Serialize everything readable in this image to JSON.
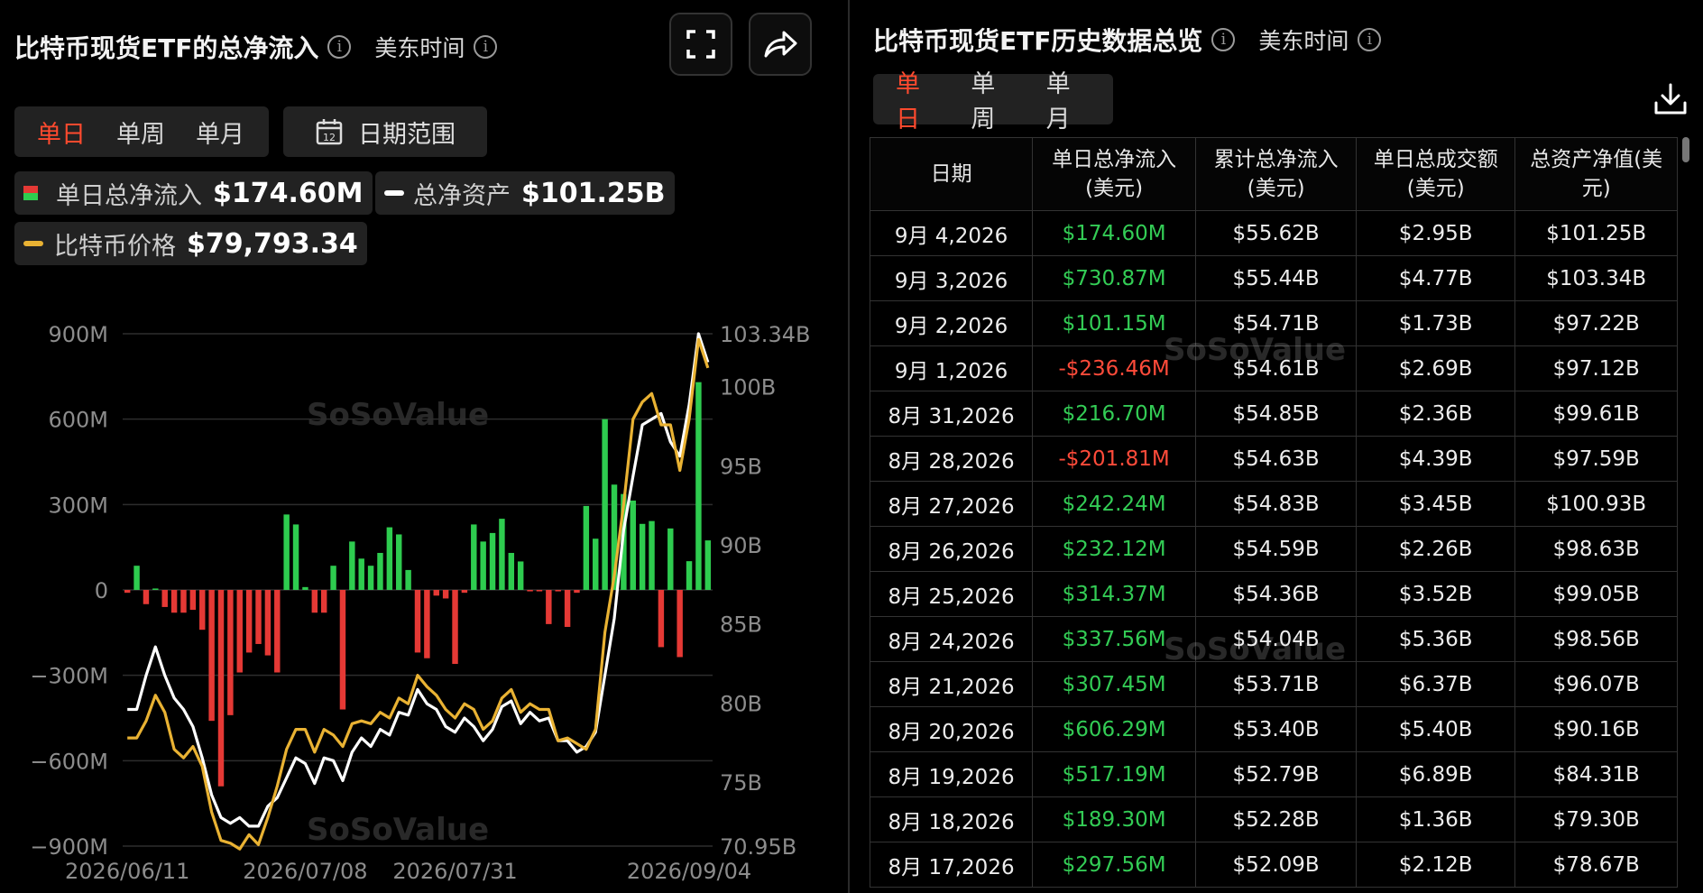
{
  "left": {
    "title": "比特币现货ETF的总净流入",
    "tz": "美东时间",
    "tabs": [
      "单日",
      "单周",
      "单月"
    ],
    "active_tab": 0,
    "date_range": "日期范围",
    "legend": [
      {
        "label": "单日总净流入",
        "value": "$174.60M"
      },
      {
        "label": "总净资产",
        "value": "$101.25B"
      },
      {
        "label": "比特币价格",
        "value": "$79,793.34"
      }
    ]
  },
  "right": {
    "title": "比特币现货ETF历史数据总览",
    "tz": "美东时间",
    "tabs": [
      "单日",
      "单周",
      "单月"
    ],
    "active_tab": 0,
    "columns": [
      [
        "日期",
        ""
      ],
      [
        "单日总净流入",
        "(美元)"
      ],
      [
        "累计总净流入",
        "(美元)"
      ],
      [
        "单日总成交额",
        "(美元)"
      ],
      [
        "总资产净值(美",
        "元)"
      ]
    ],
    "rows": [
      [
        "9月 4,2026",
        "$174.60M",
        "$55.62B",
        "$2.95B",
        "$101.25B"
      ],
      [
        "9月 3,2026",
        "$730.87M",
        "$55.44B",
        "$4.77B",
        "$103.34B"
      ],
      [
        "9月 2,2026",
        "$101.15M",
        "$54.71B",
        "$1.73B",
        "$97.22B"
      ],
      [
        "9月 1,2026",
        "-$236.46M",
        "$54.61B",
        "$2.69B",
        "$97.12B"
      ],
      [
        "8月 31,2026",
        "$216.70M",
        "$54.85B",
        "$2.36B",
        "$99.61B"
      ],
      [
        "8月 28,2026",
        "-$201.81M",
        "$54.63B",
        "$4.39B",
        "$97.59B"
      ],
      [
        "8月 27,2026",
        "$242.24M",
        "$54.83B",
        "$3.45B",
        "$100.93B"
      ],
      [
        "8月 26,2026",
        "$232.12M",
        "$54.59B",
        "$2.26B",
        "$98.63B"
      ],
      [
        "8月 25,2026",
        "$314.37M",
        "$54.36B",
        "$3.52B",
        "$99.05B"
      ],
      [
        "8月 24,2026",
        "$337.56M",
        "$54.04B",
        "$5.36B",
        "$98.56B"
      ],
      [
        "8月 21,2026",
        "$307.45M",
        "$53.71B",
        "$6.37B",
        "$96.07B"
      ],
      [
        "8月 20,2026",
        "$606.29M",
        "$53.40B",
        "$5.40B",
        "$90.16B"
      ],
      [
        "8月 19,2026",
        "$517.19M",
        "$52.79B",
        "$6.89B",
        "$84.31B"
      ],
      [
        "8月 18,2026",
        "$189.30M",
        "$52.28B",
        "$1.36B",
        "$79.30B"
      ],
      [
        "8月 17,2026",
        "$297.56M",
        "$52.09B",
        "$2.12B",
        "$78.67B"
      ]
    ]
  },
  "watermark": {
    "brand": "SoSoValue",
    "url": "sosovalue.com"
  },
  "colors": {
    "inflow": "#2ecc4f",
    "outflow": "#e53935",
    "assets": "#ffffff",
    "price": "#e9b233",
    "active_tab": "#ff4a2e"
  },
  "chart_data": {
    "type": "bar",
    "left_axis": {
      "ticks": [
        "900M",
        "600M",
        "300M",
        "0",
        "−300M",
        "−600M",
        "−900M"
      ],
      "values": [
        900,
        600,
        300,
        0,
        -300,
        -600,
        -900
      ],
      "ylim": [
        -900,
        900
      ],
      "unit": "M"
    },
    "right_axis": {
      "ticks": [
        "103.34B",
        "100B",
        "95B",
        "90B",
        "85B",
        "80B",
        "75B",
        "70.95B"
      ],
      "values": [
        103.34,
        100,
        95,
        90,
        85,
        80,
        75,
        70.95
      ],
      "ylim": [
        70.95,
        103.34
      ],
      "unit": "B"
    },
    "x_ticks": [
      "2026/06/11",
      "2026/07/08",
      "2026/07/31",
      "2026/09/04"
    ],
    "x_tick_index": [
      0,
      19,
      35,
      60
    ],
    "grid": true,
    "series": [
      {
        "name": "单日总净流入",
        "axis": "left",
        "values": [
          -10,
          85,
          -50,
          5,
          -60,
          -80,
          -80,
          -70,
          -140,
          -460,
          -690,
          -440,
          -290,
          -220,
          -190,
          -230,
          -290,
          265,
          230,
          10,
          -80,
          -80,
          85,
          -420,
          170,
          110,
          85,
          130,
          220,
          195,
          70,
          -220,
          -240,
          -20,
          -30,
          -260,
          -10,
          230,
          170,
          200,
          250,
          130,
          100,
          -5,
          -5,
          -120,
          -5,
          -130,
          -10,
          295,
          180,
          600,
          370,
          337,
          314,
          232,
          242,
          -201,
          216,
          -236,
          101,
          730,
          174
        ]
      },
      {
        "name": "总净资产",
        "axis": "left",
        "values": [
          -420,
          -420,
          -300,
          -200,
          -300,
          -380,
          -420,
          -480,
          -590,
          -720,
          -800,
          -820,
          -800,
          -830,
          -830,
          -760,
          -730,
          -660,
          -590,
          -610,
          -680,
          -590,
          -600,
          -670,
          -570,
          -520,
          -550,
          -490,
          -510,
          -430,
          -440,
          -350,
          -400,
          -420,
          -480,
          -500,
          -450,
          -480,
          -530,
          -490,
          -410,
          -390,
          -470,
          -430,
          -460,
          -450,
          -530,
          -530,
          -570,
          -550,
          -500,
          -300,
          -100,
          210,
          400,
          580,
          600,
          620,
          520,
          470,
          650,
          900,
          800
        ]
      },
      {
        "name": "比特币价格",
        "axis": "left",
        "values": [
          -520,
          -520,
          -460,
          -370,
          -430,
          -560,
          -590,
          -550,
          -620,
          -780,
          -880,
          -890,
          -910,
          -860,
          -895,
          -800,
          -690,
          -560,
          -490,
          -490,
          -570,
          -490,
          -510,
          -550,
          -470,
          -460,
          -470,
          -430,
          -450,
          -380,
          -400,
          -300,
          -340,
          -370,
          -420,
          -450,
          -400,
          -420,
          -490,
          -460,
          -380,
          -350,
          -430,
          -400,
          -420,
          -420,
          -530,
          -520,
          -540,
          -560,
          -490,
          -150,
          50,
          300,
          600,
          660,
          690,
          580,
          580,
          420,
          600,
          880,
          780
        ]
      }
    ]
  }
}
